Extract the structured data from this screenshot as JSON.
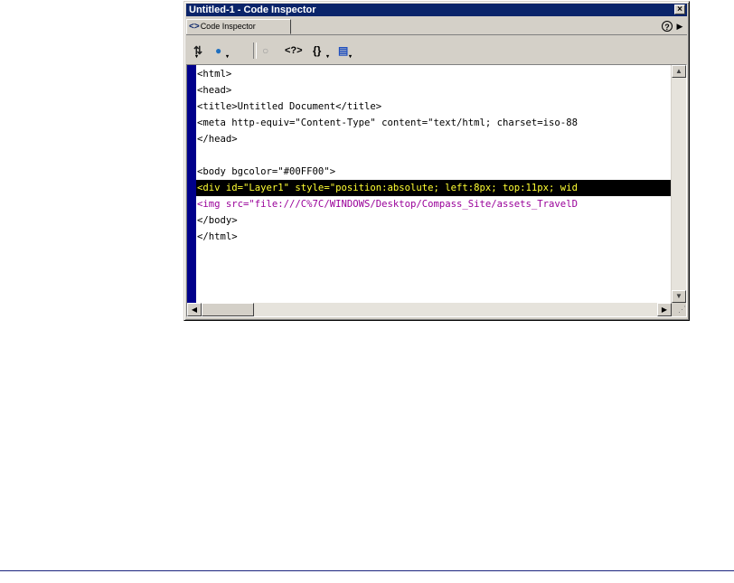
{
  "window": {
    "title": "Untitled-1 - Code Inspector",
    "close_glyph": "×"
  },
  "tabs": {
    "active": {
      "icon": "<>",
      "label": "Code Inspector"
    },
    "help_glyph": "?",
    "menu_glyph": "▶"
  },
  "toolbar": {
    "items": [
      {
        "icon": "file-management-icon",
        "glyph": "⇅"
      },
      {
        "icon": "preview-in-browser-icon",
        "glyph": "●"
      },
      {
        "icon": "refresh-icon",
        "glyph": "○"
      },
      {
        "icon": "reference-icon",
        "glyph": "<?>"
      },
      {
        "icon": "code-navigation-icon",
        "glyph": "{}"
      },
      {
        "icon": "view-options-icon",
        "glyph": "▤"
      }
    ]
  },
  "code": {
    "lines": [
      "<html>",
      "<head>",
      "<title>Untitled Document</title>",
      "<meta http-equiv=\"Content-Type\" content=\"text/html; charset=iso-88",
      "</head>",
      "",
      "<body bgcolor=\"#00FF00\">",
      "<div id=\"Layer1\" style=\"position:absolute; left:8px; top:11px; wid",
      "<img src=\"file:///C%7C/WINDOWS/Desktop/Compass_Site/assets_TravelD",
      "</body>",
      "</html>"
    ],
    "selected_line": 7,
    "magenta_line": 8
  },
  "colors": {
    "titlebar": "#0a246a",
    "gutter": "#00008b",
    "selection_bg": "#000000",
    "selection_fg": "#ffff33",
    "tag_magenta": "#990099"
  }
}
